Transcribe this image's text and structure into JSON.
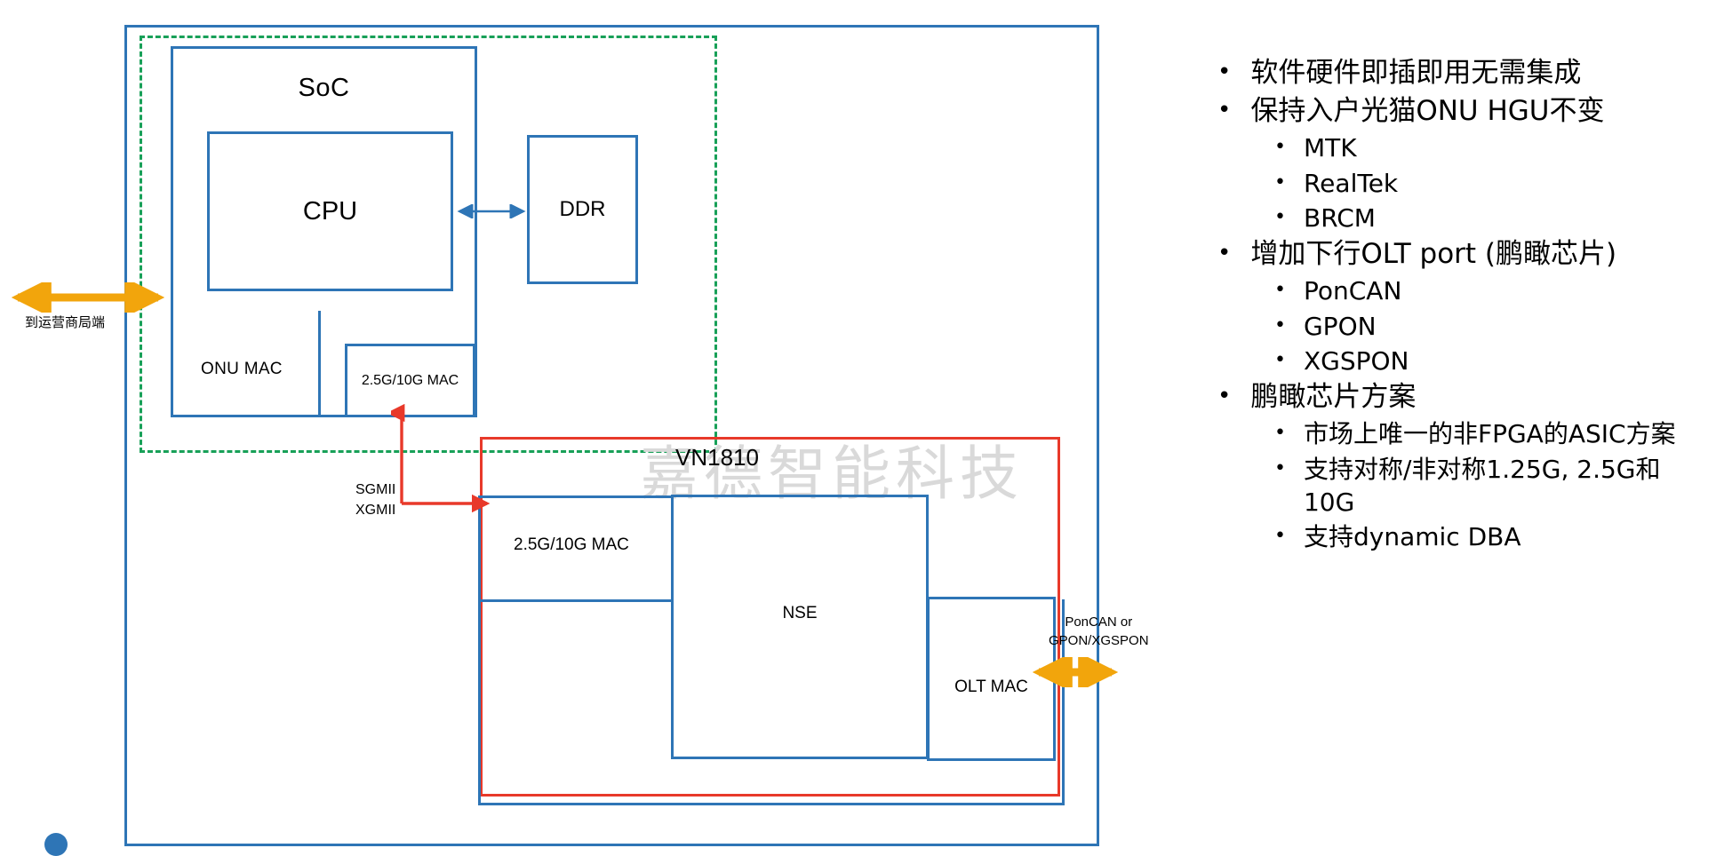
{
  "diagram": {
    "title_watermark": "嘉德智能科技",
    "vn_label": "VN1810",
    "soc_label": "SoC",
    "cpu_label": "CPU",
    "ddr_label": "DDR",
    "onu_mac_label": "ONU MAC",
    "mac_top_label": "2.5G/10G MAC",
    "mac_low_label": "2.5G/10G MAC",
    "nse_label": "NSE",
    "olt_mac_label": "OLT MAC",
    "sgmii_label_line1": "SGMII",
    "sgmii_label_line2": "XGMII",
    "left_arrow_label": "到运营商局端",
    "right_arrow_label_line1": "PonCAN or",
    "right_arrow_label_line2": "GPON/XGSPON",
    "colors": {
      "blue": "#2e75b6",
      "green_dashed": "#18a058",
      "red": "#e8392a",
      "orange": "#f2a50c",
      "watermark": "#d9d9d9"
    }
  },
  "bullets": [
    {
      "level": 1,
      "text": "软件硬件即插即用无需集成"
    },
    {
      "level": 1,
      "text": "保持入户光猫ONU HGU不变"
    },
    {
      "level": 2,
      "text": "MTK"
    },
    {
      "level": 2,
      "text": "RealTek"
    },
    {
      "level": 2,
      "text": "BRCM"
    },
    {
      "level": 1,
      "text": "增加下行OLT port (鹏瞰芯片)"
    },
    {
      "level": 2,
      "text": "PonCAN"
    },
    {
      "level": 2,
      "text": "GPON"
    },
    {
      "level": 2,
      "text": "XGSPON"
    },
    {
      "level": 1,
      "text": "鹏瞰芯片方案"
    },
    {
      "level": 2,
      "text": "市场上唯一的非FPGA的ASIC方案"
    },
    {
      "level": 2,
      "text": "支持对称/非对称1.25G, 2.5G和10G"
    },
    {
      "level": 2,
      "text": "支持dynamic DBA"
    }
  ],
  "bullet_marker": "•"
}
